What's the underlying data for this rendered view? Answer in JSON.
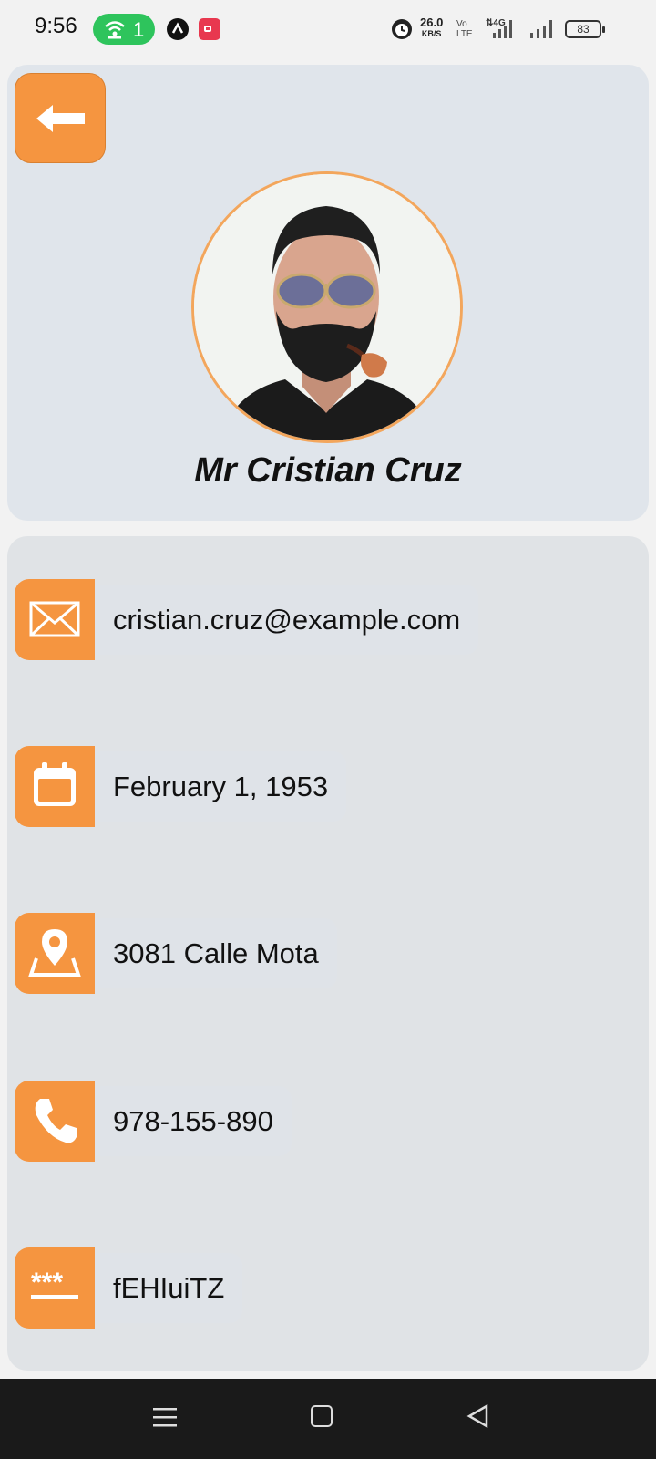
{
  "status_bar": {
    "time": "9:56",
    "hotspot_count": "1",
    "net_speed": "26.0",
    "net_speed_unit": "KB/S",
    "volte": "Vo LTE",
    "network": "4G",
    "battery": "83"
  },
  "profile": {
    "name": "Mr Cristian Cruz",
    "accent_color": "#f59540"
  },
  "details": [
    {
      "icon": "mail-icon",
      "value": "cristian.cruz@example.com"
    },
    {
      "icon": "calendar-icon",
      "value": "February 1, 1953"
    },
    {
      "icon": "location-icon",
      "value": "3081 Calle Mota"
    },
    {
      "icon": "phone-icon",
      "value": "978-155-890"
    },
    {
      "icon": "password-icon",
      "value": "fEHIuiTZ"
    }
  ]
}
